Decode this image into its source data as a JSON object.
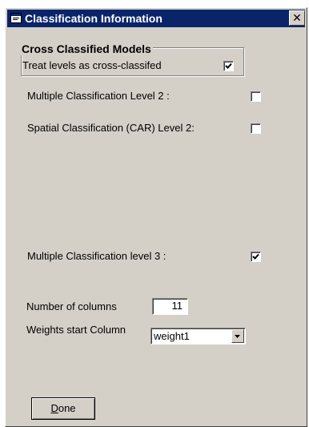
{
  "window": {
    "title": "Classification Information",
    "close_label": "✕"
  },
  "cross_group": {
    "title": "Cross Classified Models",
    "treat_label": "Treat levels as cross-classifed",
    "treat_checked": true
  },
  "options": {
    "multi_l2_label": "Multiple Classification Level 2 :",
    "multi_l2_checked": false,
    "spatial_label": "Spatial Classification (CAR) Level 2:",
    "spatial_checked": false,
    "multi_l3_label": "Multiple Classification level 3 :",
    "multi_l3_checked": true
  },
  "columns": {
    "label": "Number of columns",
    "value": "11"
  },
  "weights": {
    "label": "Weights start Column",
    "selected": "weight1"
  },
  "done_button": {
    "mnemonic": "D",
    "rest": "one"
  },
  "colors": {
    "titlebar": "#0a246a",
    "dialog_face": "#d4d0c8"
  },
  "icons": {
    "title": "window-icon",
    "close": "close-icon",
    "check": "checkmark-icon",
    "dropdown": "chevron-down-icon"
  }
}
